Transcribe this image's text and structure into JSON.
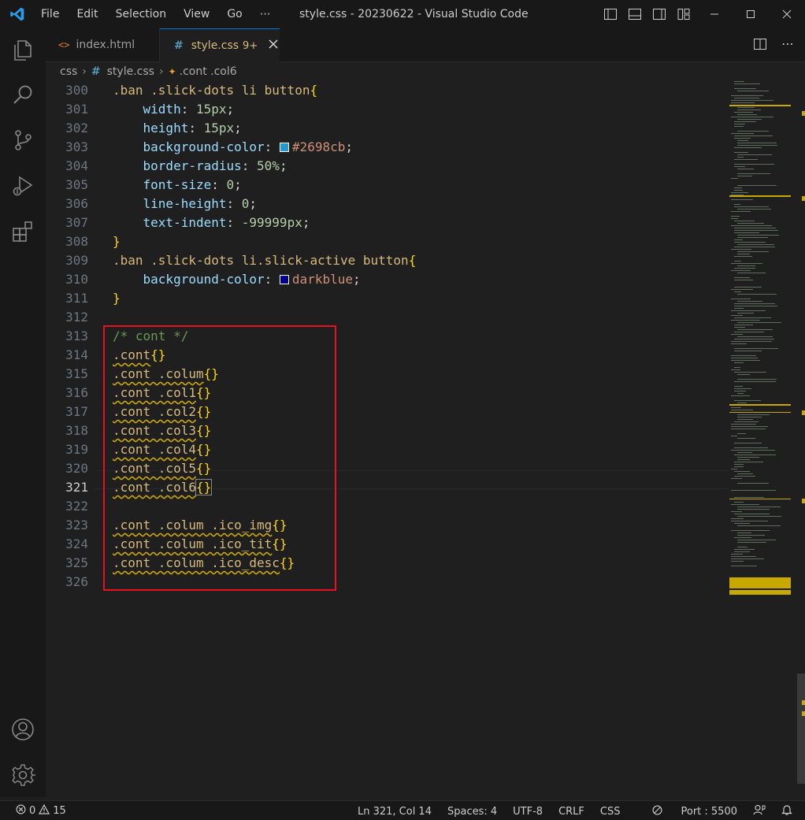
{
  "titlebar": {
    "menu": [
      "File",
      "Edit",
      "Selection",
      "View",
      "Go",
      "⋯"
    ],
    "title": "style.css - 20230622 - Visual Studio Code"
  },
  "tabs": [
    {
      "label": "index.html",
      "icon": "html-icon",
      "active": false
    },
    {
      "label": "style.css",
      "badge": "9+",
      "icon": "css-icon",
      "active": true
    }
  ],
  "breadcrumb": [
    "css",
    "style.css",
    ".cont .col6"
  ],
  "editor": {
    "lines": [
      {
        "n": "300",
        "t": ".ban .slick-dots li button{"
      },
      {
        "n": "301",
        "t": "    width: 15px;"
      },
      {
        "n": "302",
        "t": "    height: 15px;"
      },
      {
        "n": "303",
        "t": "    background-color: #2698cb;"
      },
      {
        "n": "304",
        "t": "    border-radius: 50%;"
      },
      {
        "n": "305",
        "t": "    font-size: 0;"
      },
      {
        "n": "306",
        "t": "    line-height: 0;"
      },
      {
        "n": "307",
        "t": "    text-indent: -99999px;"
      },
      {
        "n": "308",
        "t": "}"
      },
      {
        "n": "309",
        "t": ".ban .slick-dots li.slick-active button{"
      },
      {
        "n": "310",
        "t": "    background-color: darkblue;"
      },
      {
        "n": "311",
        "t": "}"
      },
      {
        "n": "312",
        "t": ""
      },
      {
        "n": "313",
        "t": "/* cont */"
      },
      {
        "n": "314",
        "t": ".cont{}"
      },
      {
        "n": "315",
        "t": ".cont .colum{}"
      },
      {
        "n": "316",
        "t": ".cont .col1{}"
      },
      {
        "n": "317",
        "t": ".cont .col2{}"
      },
      {
        "n": "318",
        "t": ".cont .col3{}"
      },
      {
        "n": "319",
        "t": ".cont .col4{}"
      },
      {
        "n": "320",
        "t": ".cont .col5{}"
      },
      {
        "n": "321",
        "t": ".cont .col6{}"
      },
      {
        "n": "322",
        "t": ""
      },
      {
        "n": "323",
        "t": ".cont .colum .ico_img{}"
      },
      {
        "n": "324",
        "t": ".cont .colum .ico_tit{}"
      },
      {
        "n": "325",
        "t": ".cont .colum .ico_desc{}"
      },
      {
        "n": "326",
        "t": ""
      }
    ],
    "current_line": "321",
    "swatch_colors": {
      "l303": "#2698cb",
      "l310": "#00008b"
    }
  },
  "statusbar": {
    "errors": "0",
    "warnings": "15",
    "position": "Ln 321, Col 14",
    "spaces": "Spaces: 4",
    "encoding": "UTF-8",
    "eol": "CRLF",
    "language": "CSS",
    "port": "Port : 5500"
  }
}
